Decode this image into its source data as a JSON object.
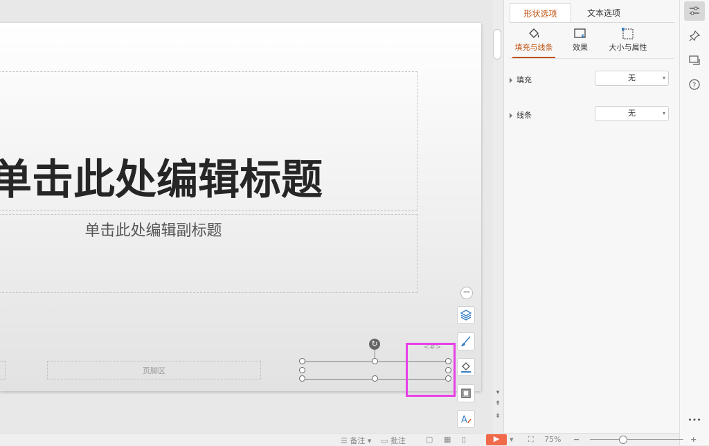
{
  "slide": {
    "title_placeholder": "单击此处编辑标题",
    "subtitle_placeholder": "单击此处编辑副标题",
    "footer_placeholder": "页脚区",
    "slide_number_placeholder": "<#>"
  },
  "float_toolbar": {
    "collapse_label": "−",
    "items": [
      "layers-icon",
      "brush-icon",
      "fill-icon",
      "border-icon",
      "text-effect-icon"
    ]
  },
  "panel": {
    "tabs": [
      "形状选项",
      "文本选项"
    ],
    "subtabs": [
      "填充与线条",
      "效果",
      "大小与属性"
    ],
    "fill": {
      "label": "填充",
      "value": "无"
    },
    "line": {
      "label": "线条",
      "value": "无"
    }
  },
  "rightbar": {
    "more_label": "•••"
  },
  "statusbar": {
    "notes_label": "备注",
    "comment_label": "批注",
    "zoom_value": "75%",
    "zoom_minus": "−",
    "zoom_plus": "+"
  },
  "colors": {
    "accent": "#c0500e",
    "highlight": "#e83fe8",
    "play": "#f06a4a"
  }
}
